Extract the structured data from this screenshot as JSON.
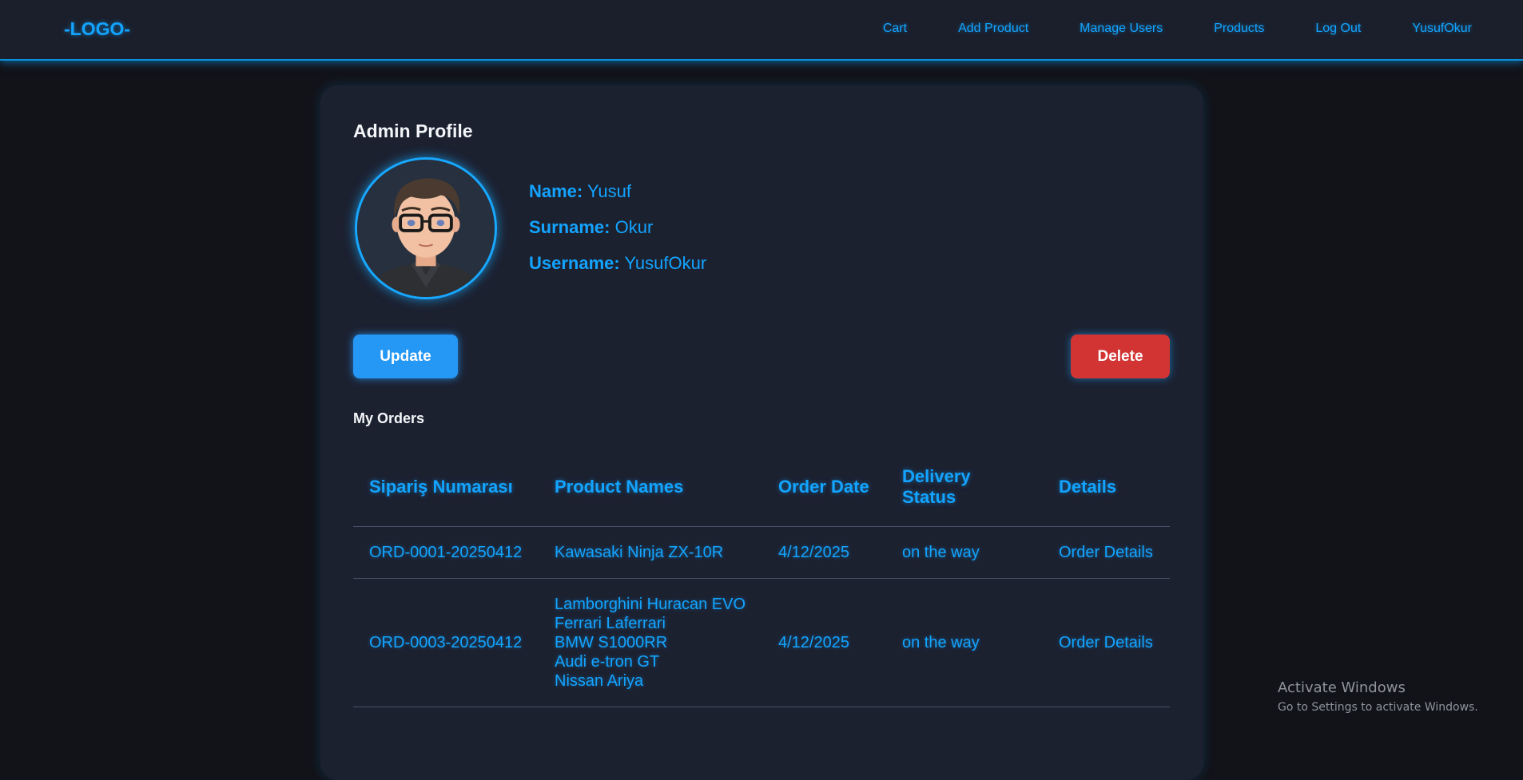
{
  "header": {
    "logo": "-LOGO-",
    "nav": [
      "Cart",
      "Add Product",
      "Manage Users",
      "Products",
      "Log Out",
      "YusufOkur"
    ]
  },
  "profile": {
    "title": "Admin Profile",
    "name_label": "Name:",
    "name": "Yusuf",
    "surname_label": "Surname:",
    "surname": "Okur",
    "username_label": "Username:",
    "username": "YusufOkur",
    "update_label": "Update",
    "delete_label": "Delete"
  },
  "orders": {
    "title": "My Orders",
    "headers": [
      "Sipariş Numarası",
      "Product Names",
      "Order Date",
      "Delivery Status",
      "Details"
    ],
    "rows": [
      {
        "id": "ORD-0001-20250412",
        "products": [
          "Kawasaki Ninja ZX-10R"
        ],
        "date": "4/12/2025",
        "status": "on the way",
        "details": "Order Details"
      },
      {
        "id": "ORD-0003-20250412",
        "products": [
          "Lamborghini Huracan EVO",
          "Ferrari Laferrari",
          "BMW S1000RR",
          "Audi e-tron GT",
          "Nissan Ariya"
        ],
        "date": "4/12/2025",
        "status": "on the way",
        "details": "Order Details"
      }
    ]
  },
  "watermark": {
    "line1": "Activate Windows",
    "line2": "Go to Settings to activate Windows."
  },
  "colors": {
    "accent": "#13a4ff",
    "background": "#121319",
    "card": "#1c2130",
    "update_button": "#2597f4",
    "delete_button": "#d23434"
  }
}
